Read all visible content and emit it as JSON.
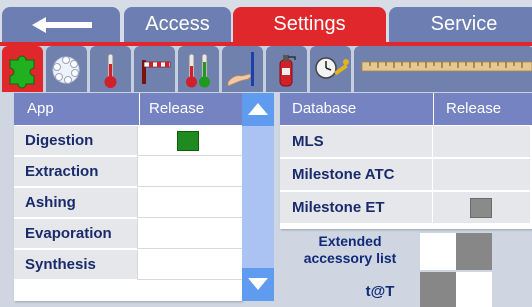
{
  "tabs": {
    "back_icon": "back-arrow-icon",
    "access": "Access",
    "settings": "Settings",
    "service": "Service"
  },
  "toolbar": {
    "icons": [
      "puzzle-icon",
      "balls-icon",
      "thermometer-icon",
      "barrier-icon",
      "thermometers-icon",
      "hand-icon",
      "fire-extinguisher-icon",
      "clock-tools-icon",
      "ruler-icon"
    ]
  },
  "app_table": {
    "headers": [
      "App",
      "Release"
    ],
    "rows": [
      {
        "name": "Digestion",
        "release": "green"
      },
      {
        "name": "Extraction",
        "release": ""
      },
      {
        "name": "Ashing",
        "release": ""
      },
      {
        "name": "Evaporation",
        "release": ""
      },
      {
        "name": "Synthesis",
        "release": ""
      }
    ]
  },
  "db_table": {
    "headers": [
      "Database",
      "Release"
    ],
    "rows": [
      {
        "name": "MLS",
        "release": ""
      },
      {
        "name": "Milestone ATC",
        "release": ""
      },
      {
        "name": "Milestone ET",
        "release": "gray"
      }
    ]
  },
  "extra": {
    "extended_accessory_line1": "Extended",
    "extended_accessory_line2": "accessory list",
    "tat": "t@T"
  },
  "colors": {
    "accent_red": "#e0282c",
    "tab_blue": "#6d7fb2",
    "header_blue": "#7683c3",
    "release_green": "#1f8a1f",
    "release_gray": "#8a8a8a"
  }
}
